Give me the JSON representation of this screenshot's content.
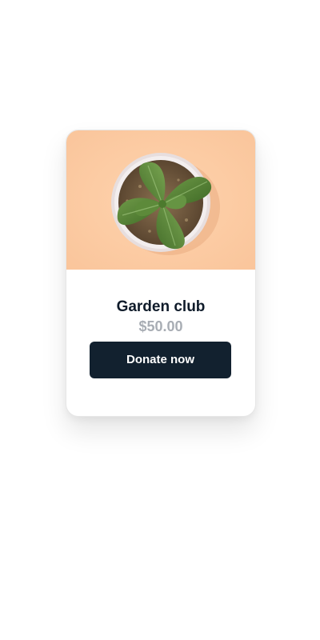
{
  "card": {
    "title": "Garden club",
    "price": "$50.00",
    "image_subject": "potted-succulent-plant",
    "cta_label": "Donate now"
  },
  "colors": {
    "image_background": "#fdcca4",
    "title_text": "#0f1b2a",
    "price_text": "#a8adb4",
    "button_background": "#12212f",
    "button_text": "#ffffff"
  }
}
